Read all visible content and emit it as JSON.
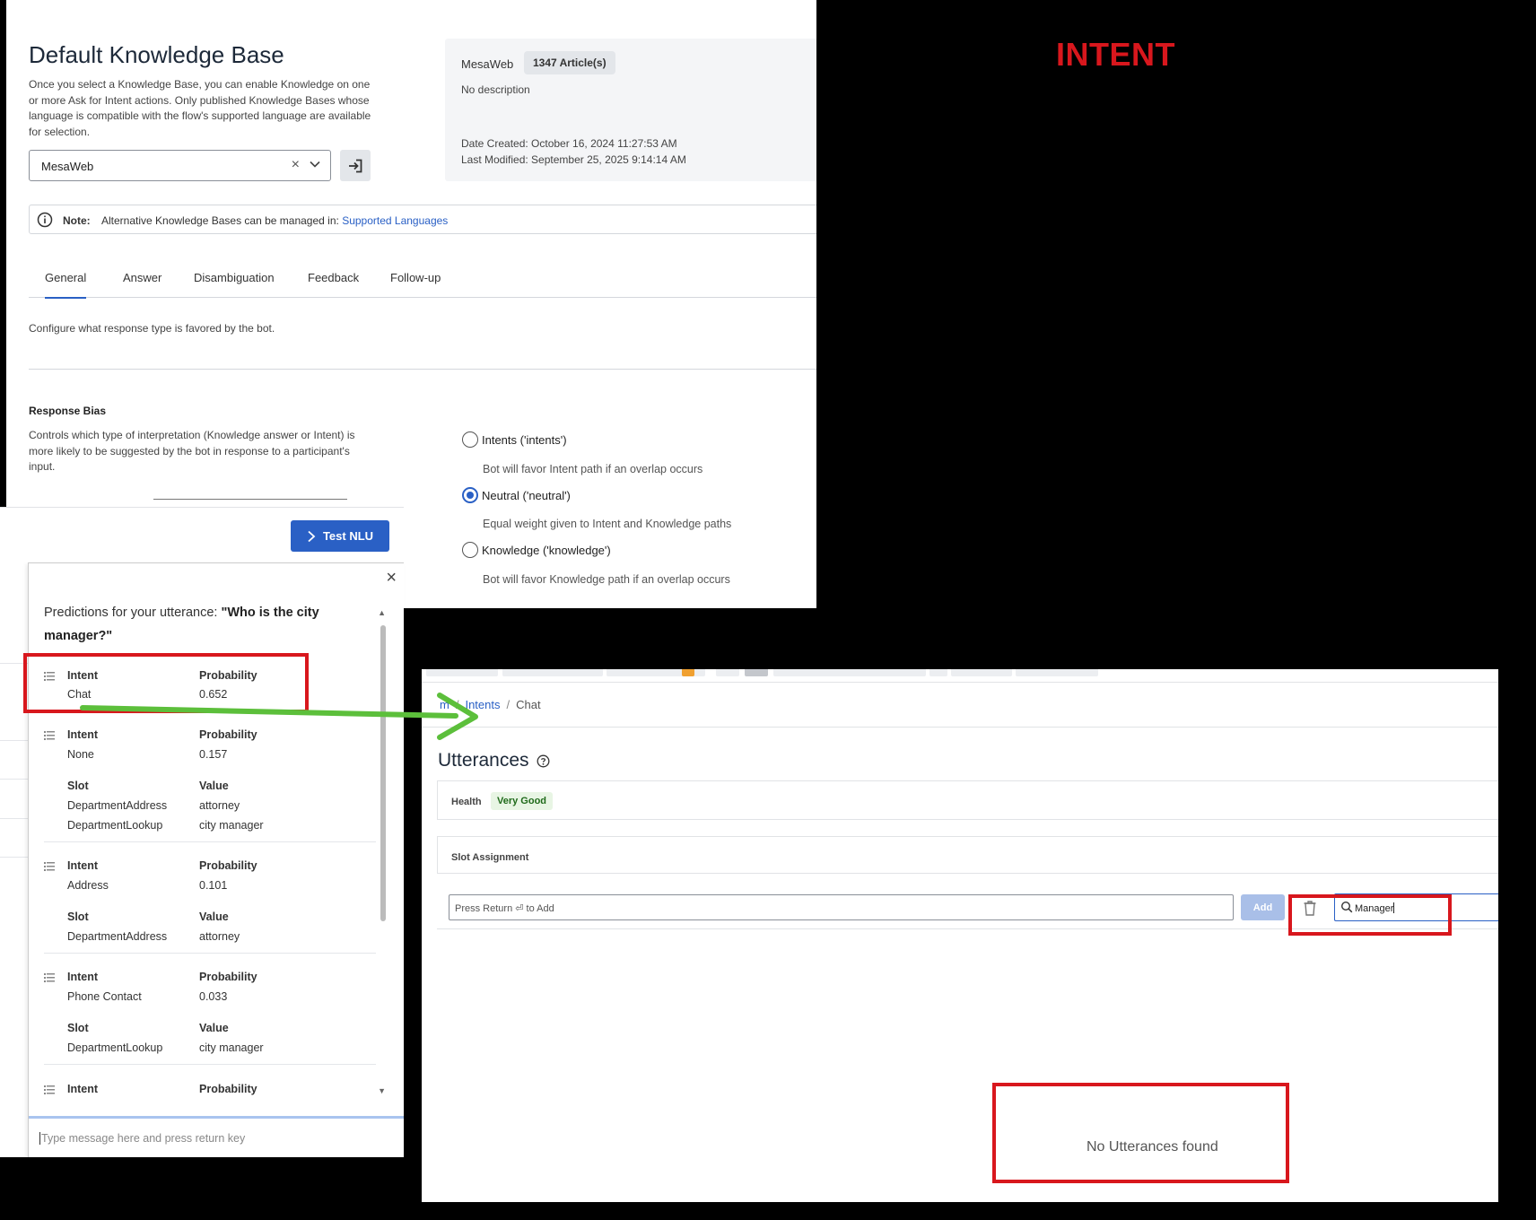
{
  "annotation": {
    "title": "INTENT",
    "arrow_color": "#5cbf3b",
    "box_color": "#d8171d"
  },
  "kb": {
    "title": "Default Knowledge Base",
    "description": "Once you select a Knowledge Base, you can enable Knowledge on one or more Ask for Intent actions. Only published Knowledge Bases whose language is compatible with the flow's supported language are available for selection.",
    "select_value": "MesaWeb",
    "clear_icon": "close-icon",
    "open_icon": "sign-in-icon",
    "info": {
      "name": "MesaWeb",
      "badge": "1347 Article(s)",
      "description": "No description",
      "date_created": "Date Created: October 16, 2024 11:27:53 AM",
      "last_modified": "Last Modified: September 25, 2025 9:14:14 AM"
    },
    "note": {
      "label": "Note:",
      "text": "Alternative Knowledge Bases can be managed in:",
      "link": "Supported Languages"
    },
    "tabs": [
      "General",
      "Answer",
      "Disambiguation",
      "Feedback",
      "Follow-up"
    ],
    "active_tab": "General",
    "config_text": "Configure what response type is favored by the bot.",
    "response_bias": {
      "title": "Response Bias",
      "description": "Controls which type of interpretation (Knowledge answer or Intent) is more likely to be suggested by the bot in response to a participant's input.",
      "options": [
        {
          "label": "Intents ('intents')",
          "help": "Bot will favor Intent path if an overlap occurs",
          "checked": false
        },
        {
          "label": "Neutral ('neutral')",
          "help": "Equal weight given to Intent and Knowledge paths",
          "checked": true
        },
        {
          "label": "Knowledge ('knowledge')",
          "help": "Bot will favor Knowledge path if an overlap occurs",
          "checked": false
        }
      ]
    }
  },
  "nlu": {
    "button_label": "Test NLU",
    "heading_prefix": "Predictions for your utterance: ",
    "utterance": "\"Who is the city manager?\"",
    "close_icon": "close-icon",
    "predictions": [
      {
        "intent_label": "Intent",
        "intent": "Chat",
        "prob_label": "Probability",
        "probability": "0.652",
        "slots": []
      },
      {
        "intent_label": "Intent",
        "intent": "None",
        "prob_label": "Probability",
        "probability": "0.157",
        "slot_label": "Slot",
        "value_label": "Value",
        "slots": [
          {
            "slot": "DepartmentAddress",
            "value": "attorney"
          },
          {
            "slot": "DepartmentLookup",
            "value": "city manager"
          }
        ]
      },
      {
        "intent_label": "Intent",
        "intent": "Address",
        "prob_label": "Probability",
        "probability": "0.101",
        "slot_label": "Slot",
        "value_label": "Value",
        "slots": [
          {
            "slot": "DepartmentAddress",
            "value": "attorney"
          }
        ]
      },
      {
        "intent_label": "Intent",
        "intent": "Phone Contact",
        "prob_label": "Probability",
        "probability": "0.033",
        "slot_label": "Slot",
        "value_label": "Value",
        "slots": [
          {
            "slot": "DepartmentLookup",
            "value": "city manager"
          }
        ]
      },
      {
        "intent_label": "Intent",
        "intent": "",
        "prob_label": "Probability",
        "probability": "",
        "slots": []
      }
    ],
    "input_placeholder": "Type message here and press return key"
  },
  "utterances": {
    "breadcrumb": {
      "home": "m",
      "link": "Intents",
      "current": "Chat"
    },
    "title": "Utterances",
    "help_icon": "help-circle-icon",
    "health_label": "Health",
    "health_value": "Very Good",
    "slot_assignment": "Slot Assignment",
    "add_placeholder": "Press Return ⏎ to Add",
    "add_button": "Add",
    "delete_icon": "trash-icon",
    "search_icon": "search-icon",
    "search_value": "Manager",
    "empty_message": "No Utterances found"
  }
}
